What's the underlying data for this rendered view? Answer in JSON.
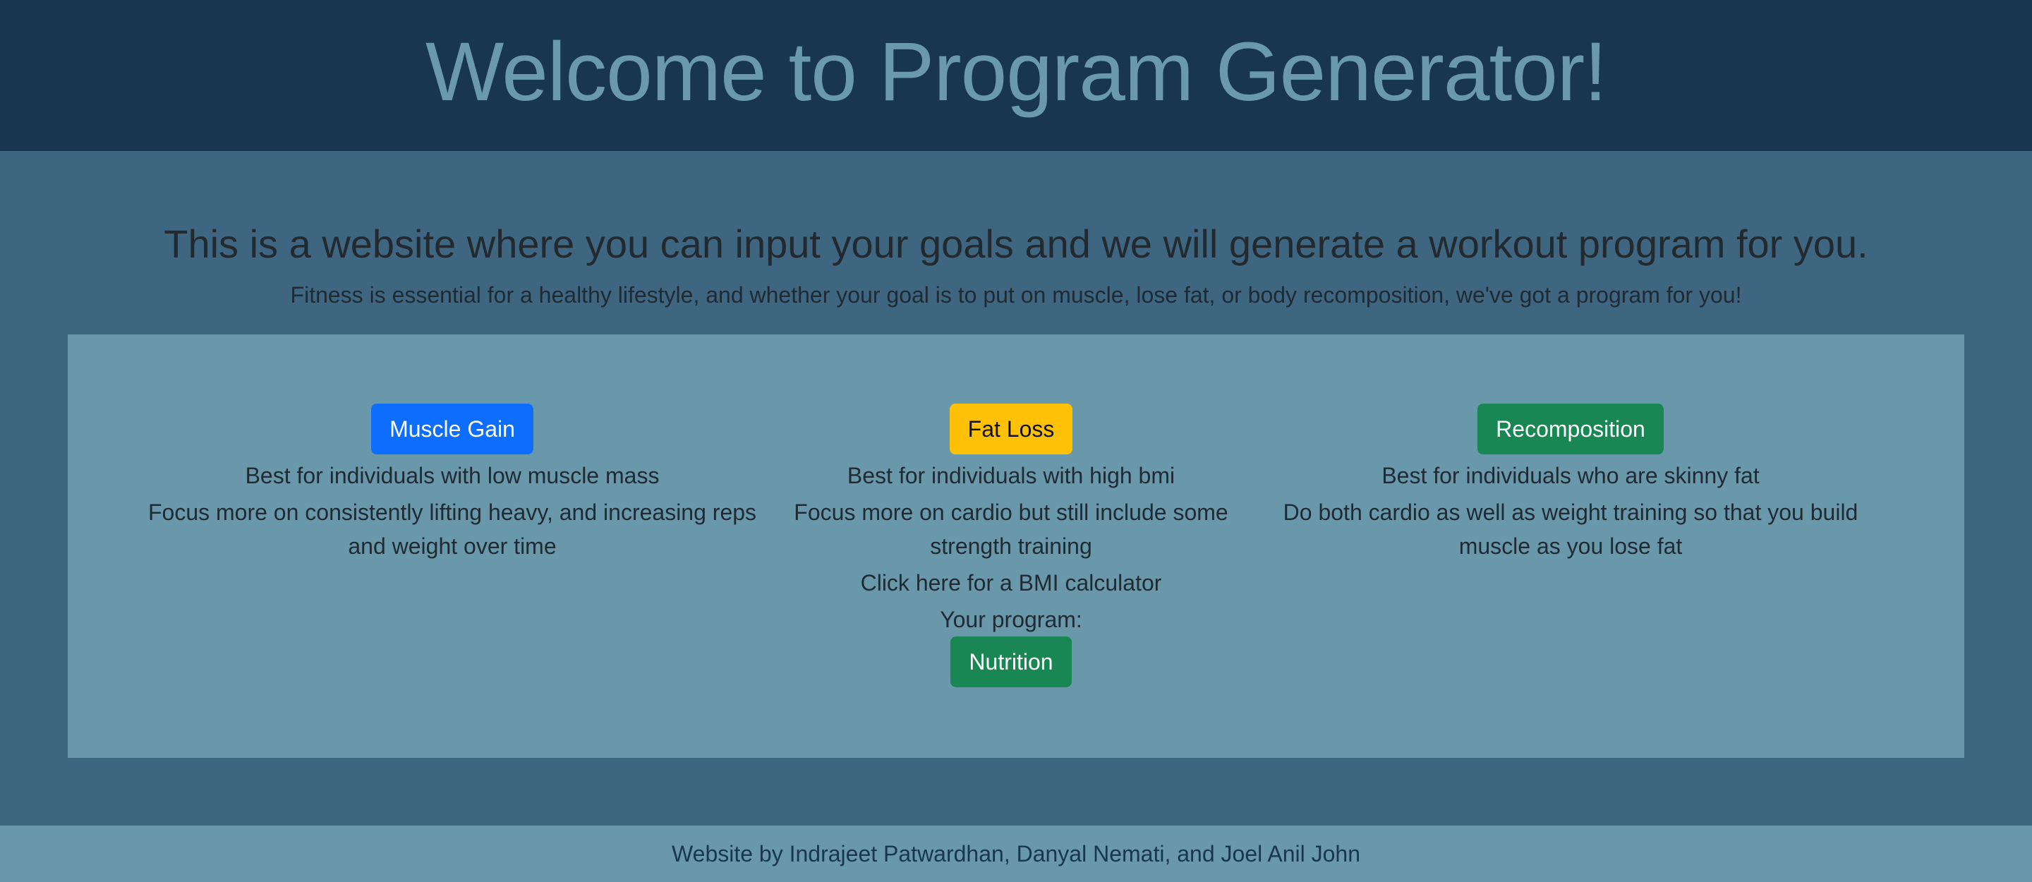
{
  "header": {
    "title": "Welcome to Program Generator!"
  },
  "intro": {
    "headline": "This is a website where you can input your goals and we will generate a workout program for you.",
    "subline": "Fitness is essential for a healthy lifestyle, and whether your goal is to put on muscle, lose fat, or body recomposition, we've got a program for you!"
  },
  "programs": [
    {
      "button_label": "Muscle Gain",
      "best_for": "Best for individuals with low muscle mass",
      "focus": "Focus more on consistently lifting heavy, and increasing reps and weight over time"
    },
    {
      "button_label": "Fat Loss",
      "best_for": "Best for individuals with high bmi",
      "focus": "Focus more on cardio but still include some strength training",
      "bmi_link": "Click here for a BMI calculator",
      "your_program_label": "Your program:",
      "nutrition_label": "Nutrition"
    },
    {
      "button_label": "Recomposition",
      "best_for": "Best for individuals who are skinny fat",
      "focus": "Do both cardio as well as weight training so that you build muscle as you lose fat"
    }
  ],
  "footer": {
    "credits": "Website by Indrajeet Patwardhan, Danyal Nemati, and Joel Anil John"
  },
  "colors": {
    "header_bg": "#18364f",
    "main_bg": "#3e6680",
    "panel_bg": "#6a98ab",
    "muscle_gain_button": "#0d6efd",
    "fat_loss_button": "#ffc107",
    "recomposition_button": "#198754",
    "nutrition_button": "#198754"
  }
}
